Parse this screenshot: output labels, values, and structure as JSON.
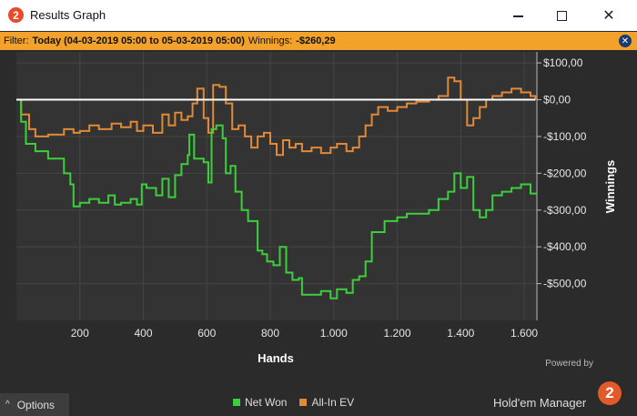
{
  "window": {
    "title": "Results Graph",
    "icon_glyph": "2",
    "minimize_icon": "minimize-icon",
    "maximize_icon": "maximize-icon",
    "close_glyph": "✕"
  },
  "filter": {
    "label": "Filter:",
    "value": "Today (04-03-2019 05:00 to 05-03-2019 05:00)",
    "winnings_label": "Winnings:",
    "winnings_value": "-$260,29",
    "close_glyph": "✕"
  },
  "footer": {
    "options_label": "Options",
    "options_chevron": "^",
    "powered_by": "Powered by",
    "brand": "Hold'em Manager",
    "brand_glyph": "2"
  },
  "colors": {
    "net_won": "#3ccf3c",
    "all_in_ev": "#e08a38",
    "zero_line": "#ffffff",
    "filter_bar": "#f2a12a",
    "background": "#2b2b2b"
  },
  "chart_data": {
    "type": "line",
    "xlabel": "Hands",
    "ylabel": "Winnings",
    "xlim": [
      0,
      1640
    ],
    "ylim": [
      -600,
      130
    ],
    "x_ticks": [
      200,
      400,
      600,
      800,
      1000,
      1200,
      1400,
      1600
    ],
    "x_tick_labels": [
      "200",
      "400",
      "600",
      "800",
      "1.000",
      "1.200",
      "1.400",
      "1.600"
    ],
    "y_ticks": [
      100,
      0,
      -100,
      -200,
      -300,
      -400,
      -500
    ],
    "y_tick_labels": [
      "$100,00",
      "$0,00",
      "-$100,00",
      "-$200,00",
      "-$300,00",
      "-$400,00",
      "-$500,00"
    ],
    "grid": true,
    "legend_position": "bottom",
    "series": [
      {
        "name": "Net Won",
        "color": "#3ccf3c",
        "x": [
          0,
          15,
          30,
          60,
          100,
          150,
          170,
          180,
          200,
          230,
          260,
          290,
          310,
          330,
          360,
          380,
          395,
          410,
          440,
          460,
          480,
          500,
          520,
          540,
          545,
          560,
          590,
          605,
          615,
          630,
          650,
          660,
          675,
          690,
          710,
          730,
          760,
          775,
          790,
          810,
          830,
          850,
          870,
          890,
          900,
          930,
          960,
          990,
          1010,
          1040,
          1060,
          1080,
          1100,
          1120,
          1160,
          1180,
          1200,
          1230,
          1260,
          1300,
          1330,
          1360,
          1380,
          1400,
          1420,
          1440,
          1460,
          1480,
          1500,
          1530,
          1560,
          1590,
          1620,
          1635
        ],
        "y": [
          0,
          -60,
          -120,
          -140,
          -160,
          -200,
          -230,
          -290,
          -280,
          -270,
          -280,
          -260,
          -285,
          -280,
          -270,
          -285,
          -230,
          -240,
          -260,
          -215,
          -265,
          -205,
          -175,
          -150,
          -95,
          -160,
          -170,
          -225,
          -80,
          -70,
          -105,
          -200,
          -180,
          -250,
          -300,
          -330,
          -410,
          -420,
          -440,
          -450,
          -400,
          -470,
          -490,
          -485,
          -530,
          -530,
          -520,
          -540,
          -515,
          -525,
          -490,
          -480,
          -440,
          -360,
          -330,
          -330,
          -320,
          -310,
          -310,
          -300,
          -270,
          -250,
          -200,
          -240,
          -210,
          -300,
          -320,
          -300,
          -260,
          -250,
          -240,
          -230,
          -255,
          -258
        ]
      },
      {
        "name": "All-In EV",
        "color": "#e08a38",
        "x": [
          0,
          15,
          40,
          60,
          100,
          150,
          180,
          200,
          230,
          260,
          300,
          330,
          360,
          380,
          400,
          430,
          460,
          480,
          500,
          520,
          540,
          555,
          570,
          590,
          605,
          620,
          640,
          660,
          680,
          700,
          720,
          740,
          760,
          780,
          800,
          820,
          840,
          860,
          880,
          900,
          930,
          960,
          990,
          1010,
          1040,
          1060,
          1080,
          1100,
          1120,
          1140,
          1170,
          1200,
          1230,
          1260,
          1300,
          1330,
          1360,
          1380,
          1400,
          1420,
          1440,
          1460,
          1480,
          1500,
          1530,
          1560,
          1590,
          1620,
          1635
        ],
        "y": [
          0,
          -40,
          -80,
          -100,
          -95,
          -80,
          -90,
          -85,
          -70,
          -80,
          -65,
          -75,
          -60,
          -85,
          -70,
          -90,
          -40,
          -70,
          -35,
          -55,
          -45,
          -10,
          30,
          -50,
          -90,
          40,
          35,
          -10,
          -80,
          -70,
          -100,
          -130,
          -100,
          -90,
          -120,
          -150,
          -110,
          -130,
          -120,
          -140,
          -130,
          -145,
          -130,
          -120,
          -140,
          -130,
          -100,
          -70,
          -40,
          -20,
          -30,
          -20,
          -10,
          -5,
          0,
          10,
          60,
          50,
          0,
          -70,
          -50,
          -20,
          0,
          10,
          20,
          30,
          20,
          10,
          0
        ]
      },
      {
        "name": "",
        "color": "#ffffff",
        "x": [
          0,
          1635
        ],
        "y": [
          0,
          0
        ]
      }
    ]
  }
}
